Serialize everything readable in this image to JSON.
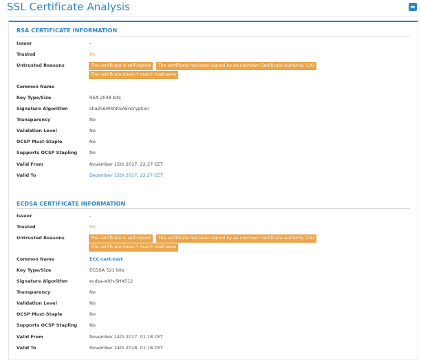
{
  "page": {
    "title": "SSL Certificate Analysis"
  },
  "rsa": {
    "title": "RSA CERTIFICATE INFORMATION",
    "rows": [
      {
        "label": "Issuer",
        "value": "-"
      },
      {
        "label": "Trusted",
        "value": "No"
      },
      {
        "label": "Untrusted Reasons",
        "badges": [
          "The certificate is self-signed",
          "The certificate has been signed by an unknown Certificate Authority (CA)",
          "The certificate doesn't match hostname"
        ]
      },
      {
        "label": "Common Name",
        "value": ""
      },
      {
        "label": "Key Type/Size",
        "value": "RSA 2048 bits"
      },
      {
        "label": "Signature Algorithm",
        "value": "sha256WithRSAEncryption"
      },
      {
        "label": "Transparency",
        "value": "No"
      },
      {
        "label": "Validation Level",
        "value": "No"
      },
      {
        "label": "OCSP Must-Staple",
        "value": "No"
      },
      {
        "label": "Supports OCSP Stapling",
        "value": "No"
      },
      {
        "label": "Valid From",
        "value": "November 15th 2017, 22:27 CET"
      },
      {
        "label": "Valid To",
        "value": "December 15th 2017, 22:27 CET"
      }
    ]
  },
  "ecdsa": {
    "title": "ECDSA CERTIFICATE INFORMATION",
    "rows": [
      {
        "label": "Issuer",
        "value": "-"
      },
      {
        "label": "Trusted",
        "value": "No"
      },
      {
        "label": "Untrusted Reasons",
        "badges": [
          "The certificate is self-signed",
          "The certificate has been signed by an unknown Certificate Authority (CA)",
          "The certificate doesn't match hostname"
        ]
      },
      {
        "label": "Common Name",
        "value": "ECC-cert-test"
      },
      {
        "label": "Key Type/Size",
        "value": "ECDSA 521 bits"
      },
      {
        "label": "Signature Algorithm",
        "value": "ecdsa-with-SHA512"
      },
      {
        "label": "Transparency",
        "value": "No"
      },
      {
        "label": "Validation Level",
        "value": "No"
      },
      {
        "label": "OCSP Must-Staple",
        "value": "No"
      },
      {
        "label": "Supports OCSP Stapling",
        "value": "No"
      },
      {
        "label": "Valid From",
        "value": "November 24th 2017, 01:18 CET"
      },
      {
        "label": "Valid To",
        "value": "November 24th 2018, 01:18 CET"
      }
    ]
  },
  "colors": {
    "accent": "#2a87c8",
    "warning": "#eaa54a"
  },
  "icons": {
    "collapse": "minus-icon"
  }
}
